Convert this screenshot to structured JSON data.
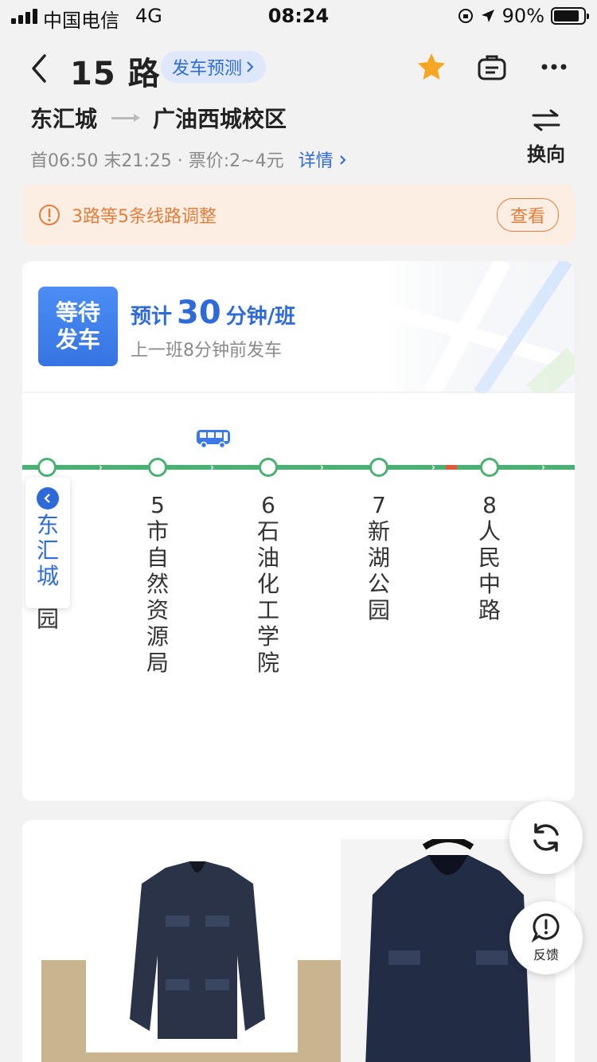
{
  "status_bar": {
    "carrier": "中国电信",
    "network": "4G",
    "time": "08:24",
    "battery": "90%"
  },
  "header": {
    "title": "15 路",
    "predict_label": "发车预测",
    "icons": [
      "back-icon",
      "star-icon",
      "briefcase-icon",
      "more-icon"
    ]
  },
  "route": {
    "from": "东汇城",
    "to": "广油西城校区",
    "schedule": "首06:50 末21:25 · 票价:2~4元",
    "detail_label": "详情",
    "switch_label": "换向"
  },
  "notice": {
    "text": "3路等5条线路调整",
    "button": "查看"
  },
  "wait": {
    "badge_line1": "等待",
    "badge_line2": "发车",
    "eta_prefix": "预计",
    "eta_value": "30",
    "eta_suffix": "分钟/班",
    "last_departure": "上一班8分钟前发车"
  },
  "start_station": {
    "name_chars": [
      "东",
      "汇",
      "城"
    ],
    "hidden_tail": "园"
  },
  "stops": [
    {
      "num": "5",
      "name_chars": [
        "市",
        "自",
        "然",
        "资",
        "源",
        "局"
      ]
    },
    {
      "num": "6",
      "name_chars": [
        "石",
        "油",
        "化",
        "工",
        "学",
        "院"
      ]
    },
    {
      "num": "7",
      "name_chars": [
        "新",
        "湖",
        "公",
        "园"
      ]
    },
    {
      "num": "8",
      "name_chars": [
        "人",
        "民",
        "中",
        "路"
      ]
    }
  ],
  "floating": {
    "feedback_label": "反馈"
  },
  "colors": {
    "accent": "#2f6bd8",
    "track": "#4caf73",
    "notice": "#e37d3a"
  }
}
